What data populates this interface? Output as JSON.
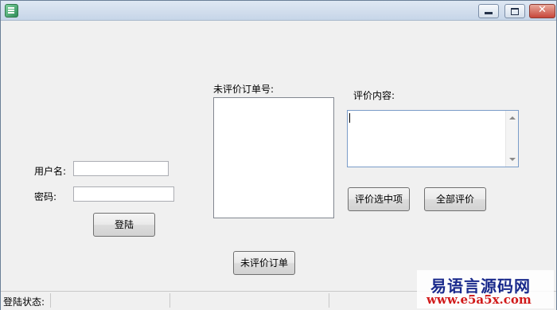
{
  "window": {
    "controls": {
      "minimize": "minimize",
      "maximize": "maximize",
      "close": "✕"
    }
  },
  "login": {
    "username_label": "用户名:",
    "username_value": "",
    "password_label": "密码:",
    "password_value": "",
    "login_button": "登陆"
  },
  "orders": {
    "list_label": "未评价订单号:",
    "items": [],
    "load_button": "未评价订单"
  },
  "review": {
    "content_label": "评价内容:",
    "content_value": "",
    "rate_selected_button": "评价选中项",
    "rate_all_button": "全部评价"
  },
  "status_bar": {
    "login_status_label": "登陆状态:"
  },
  "watermark": {
    "site_name": "易语言源码网",
    "url": "www.e5a5x.com"
  }
}
